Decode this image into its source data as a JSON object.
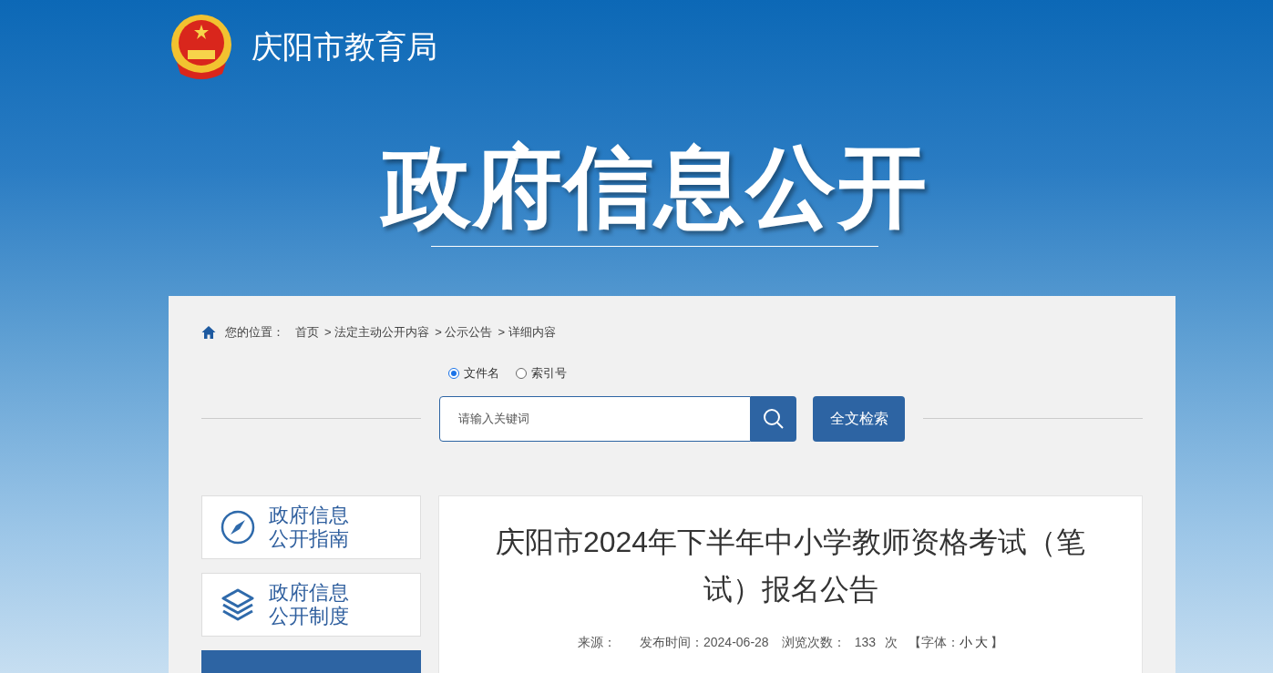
{
  "header": {
    "site_title": "庆阳市教育局"
  },
  "banner": {
    "title": "政府信息公开"
  },
  "breadcrumb": {
    "label": "您的位置：",
    "items": [
      "首页",
      "> 法定主动公开内容",
      "> 公示公告",
      "> 详细内容"
    ]
  },
  "search": {
    "modes": [
      {
        "label": "文件名",
        "selected": true
      },
      {
        "label": "索引号",
        "selected": false
      }
    ],
    "placeholder": "请输入关键词",
    "fulltext_button": "全文检索"
  },
  "sidebar": {
    "items": [
      {
        "kind": "compass",
        "lines": [
          "政府信息",
          "公开指南"
        ]
      },
      {
        "kind": "layers",
        "lines": [
          "政府信息",
          "公开制度"
        ]
      }
    ]
  },
  "article": {
    "title": "庆阳市2024年下半年中小学教师资格考试（笔试）报名公告",
    "meta": {
      "source_label": "来源：",
      "date": "发布时间：2024-06-28",
      "views_label": "浏览次数：",
      "views": "133",
      "views_unit": "次",
      "font_prefix": "【字体：",
      "font_options": [
        "小",
        "大"
      ],
      "font_suffix": "】"
    }
  }
}
